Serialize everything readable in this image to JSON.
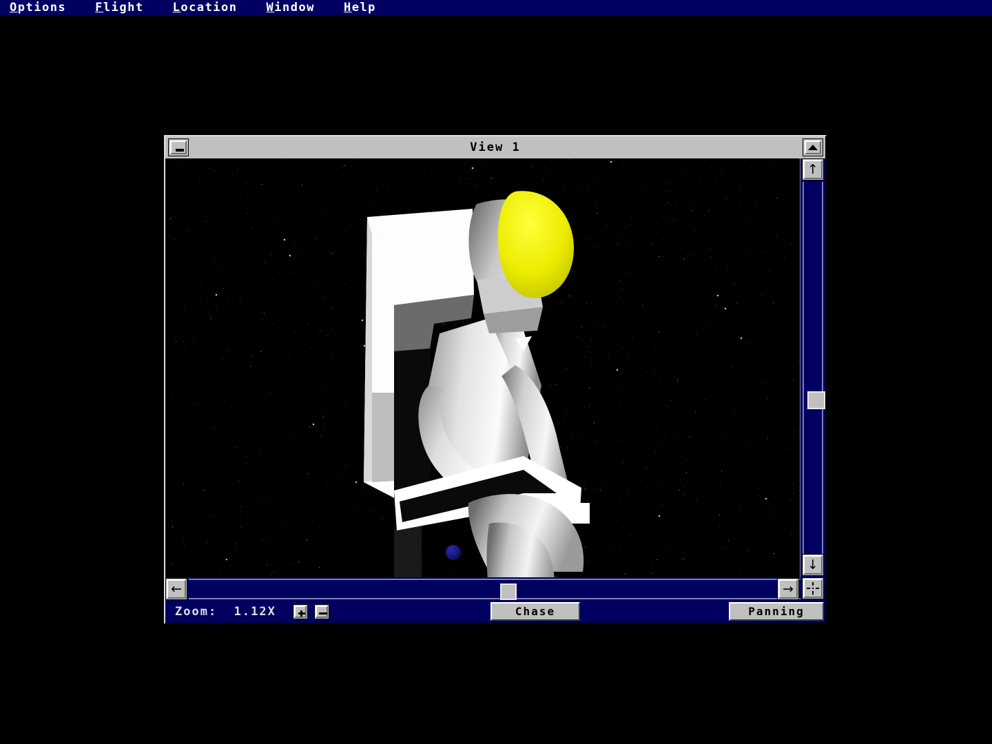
{
  "menubar": {
    "items": [
      {
        "name": "options",
        "accel": "O",
        "rest": "ptions"
      },
      {
        "name": "flight",
        "accel": "F",
        "rest": "light"
      },
      {
        "name": "location",
        "accel": "L",
        "rest": "ocation"
      },
      {
        "name": "window",
        "accel": "W",
        "rest": "indow"
      },
      {
        "name": "help",
        "accel": "H",
        "rest": "elp"
      }
    ]
  },
  "window": {
    "title": "View 1",
    "minimize_glyph": "minimize-icon",
    "maximize_glyph": "maximize-icon"
  },
  "viewport": {
    "description": "Astronaut in white spacesuit with yellow helmet visor seated in a white Manned Maneuvering Unit against a black star field",
    "background_color": "#000000",
    "suit_color": "#f0f0f0",
    "visor_color": "#e8e800",
    "planet_color": "#101070",
    "cursor": "arrow-cursor"
  },
  "scrollbars": {
    "vertical": {
      "up_arrow": "↑",
      "down_arrow": "↓",
      "thumb_position_percent": 52
    },
    "horizontal": {
      "left_arrow": "←",
      "right_arrow": "→",
      "thumb_position_percent": 50
    },
    "center_icon": "pan-center-icon",
    "track_color": "#000060",
    "thumb_color": "#c0c0c0"
  },
  "statusbar": {
    "zoom_label": "Zoom:  1.12X",
    "zoom_value": "1.12X",
    "zoom_in_label": "+",
    "zoom_out_label": "−",
    "chase_label": "Chase",
    "panning_label": "Panning"
  },
  "colors": {
    "menu_background": "#000060",
    "window_chrome": "#c0c0c0",
    "navy": "#000060",
    "text_light": "#e0e0e0"
  }
}
